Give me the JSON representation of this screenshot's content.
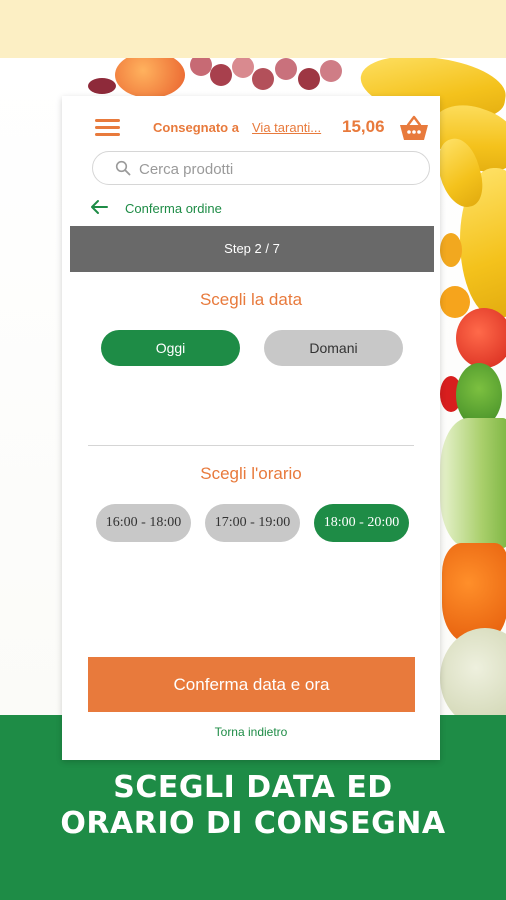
{
  "header": {
    "delivered_label": "Consegnato a",
    "address": "Via taranti...",
    "total": "15,06"
  },
  "search": {
    "placeholder": "Cerca prodotti"
  },
  "nav": {
    "back_label": "Conferma ordine"
  },
  "step": {
    "label": "Step 2 / 7"
  },
  "date": {
    "title": "Scegli la data",
    "options": [
      {
        "label": "Oggi",
        "selected": true
      },
      {
        "label": "Domani",
        "selected": false
      }
    ]
  },
  "time": {
    "title": "Scegli l'orario",
    "slots": [
      {
        "label": "16:00 - 18:00",
        "selected": false
      },
      {
        "label": "17:00 - 19:00",
        "selected": false
      },
      {
        "label": "18:00 - 20:00",
        "selected": true
      }
    ]
  },
  "actions": {
    "confirm_label": "Conferma data e ora",
    "back_label": "Torna indietro"
  },
  "promo": {
    "line1": "SCEGLI DATA ED",
    "line2": "ORARIO DI CONSEGNA"
  },
  "colors": {
    "brand_green": "#1e8c46",
    "brand_orange": "#e87a3c",
    "inactive_gray": "#c8c8c8",
    "step_bar": "#696969",
    "top_band": "#fcefc4"
  },
  "icons": [
    "menu-icon",
    "basket-icon",
    "search-icon",
    "back-arrow-icon"
  ]
}
